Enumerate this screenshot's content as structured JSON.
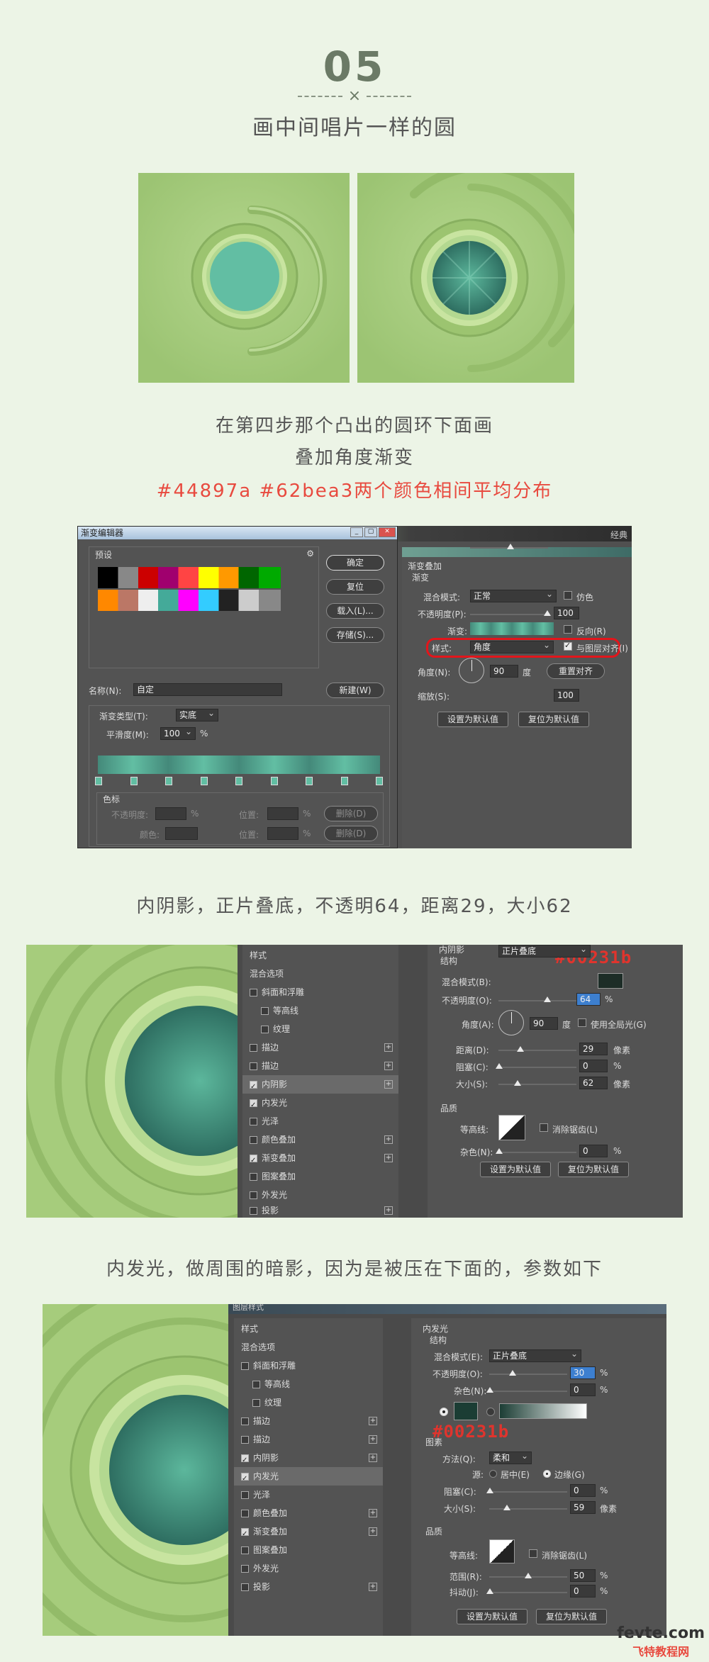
{
  "header": {
    "step_number": "05",
    "divider_mark": "×",
    "title": "画中间唱片一样的圆"
  },
  "captions": {
    "line1": "在第四步那个凸出的圆环下面画",
    "line2": "叠加角度渐变",
    "line3": "#44897a  #62bea3两个颜色相间平均分布",
    "inner_shadow": "内阴影，正片叠底，不透明64，距离29，大小62",
    "inner_glow": "内发光，做周围的暗影，因为是被压在下面的，参数如下"
  },
  "colors": {
    "page_bg": "#ecf4e6",
    "panel_green": "#a6cc7c",
    "teal": "#62bea3",
    "teal_dark": "#44897a",
    "shadow": "#00231b",
    "accent_red": "#e84a3f"
  },
  "gradient_editor": {
    "title": "渐变编辑器",
    "presets_label": "预设",
    "ok": "确定",
    "reset": "复位",
    "load": "载入(L)...",
    "save": "存储(S)...",
    "name_label": "名称(N):",
    "name_value": "自定",
    "new": "新建(W)",
    "type_label": "渐变类型(T):",
    "type_value": "实底",
    "smooth_label": "平滑度(M):",
    "smooth_value": "100",
    "percent": "%",
    "stops_label": "色标",
    "opacity_label": "不透明度:",
    "position_label": "位置:",
    "delete_label": "删除(D)",
    "color_label": "颜色:"
  },
  "gradient_overlay": {
    "section": "渐变叠加",
    "subsection": "渐变",
    "blend_label": "混合模式:",
    "blend_value": "正常",
    "dither": "仿色",
    "opacity_label": "不透明度(P):",
    "opacity_value": "100",
    "gradient_label": "渐变:",
    "reverse": "反向(R)",
    "style_label": "样式:",
    "style_value": "角度",
    "align": "与图层对齐(I)",
    "angle_label": "角度(N):",
    "angle_value": "90",
    "degree": "度",
    "reset_align": "重置对齐",
    "scale_label": "缩放(S):",
    "scale_value": "100",
    "make_default": "设置为默认值",
    "reset_default": "复位为默认值",
    "top_right_tab": "经典"
  },
  "layer_styles": {
    "items": [
      "样式",
      "混合选项",
      "斜面和浮雕",
      "等高线",
      "纹理",
      "描边",
      "描边",
      "内阴影",
      "内发光",
      "光泽",
      "颜色叠加",
      "渐变叠加",
      "图案叠加",
      "外发光",
      "投影"
    ]
  },
  "inner_shadow": {
    "section": "内阴影",
    "subsection": "结构",
    "hex": "#00231b",
    "blend_label": "混合模式(B):",
    "blend_value": "正片叠底",
    "opacity_label": "不透明度(O):",
    "opacity_value": "64",
    "angle_label": "角度(A):",
    "angle_value": "90",
    "degree": "度",
    "global_light": "使用全局光(G)",
    "distance_label": "距离(D):",
    "distance_value": "29",
    "choke_label": "阻塞(C):",
    "choke_value": "0",
    "size_label": "大小(S):",
    "size_value": "62",
    "px": "像素",
    "percent": "%",
    "quality": "品质",
    "contour_label": "等高线:",
    "antialias": "消除锯齿(L)",
    "noise_label": "杂色(N):",
    "noise_value": "0",
    "make_default": "设置为默认值",
    "reset_default": "复位为默认值"
  },
  "inner_glow": {
    "window_title": "图层样式",
    "section": "内发光",
    "subsection": "结构",
    "hex": "#00231b",
    "blend_label": "混合模式(E):",
    "blend_value": "正片叠底",
    "opacity_label": "不透明度(O):",
    "opacity_value": "30",
    "noise_label": "杂色(N):",
    "noise_value": "0",
    "elements": "图素",
    "technique_label": "方法(Q):",
    "technique_value": "柔和",
    "source_label": "源:",
    "center": "居中(E)",
    "edge": "边缘(G)",
    "choke_label": "阻塞(C):",
    "choke_value": "0",
    "size_label": "大小(S):",
    "size_value": "59",
    "px": "像素",
    "percent": "%",
    "quality": "品质",
    "contour_label": "等高线:",
    "antialias": "消除锯齿(L)",
    "range_label": "范围(R):",
    "range_value": "50",
    "jitter_label": "抖动(J):",
    "jitter_value": "0",
    "make_default": "设置为默认值",
    "reset_default": "复位为默认值"
  },
  "watermark": {
    "site": "fevte.com",
    "name": "飞特教程网"
  }
}
